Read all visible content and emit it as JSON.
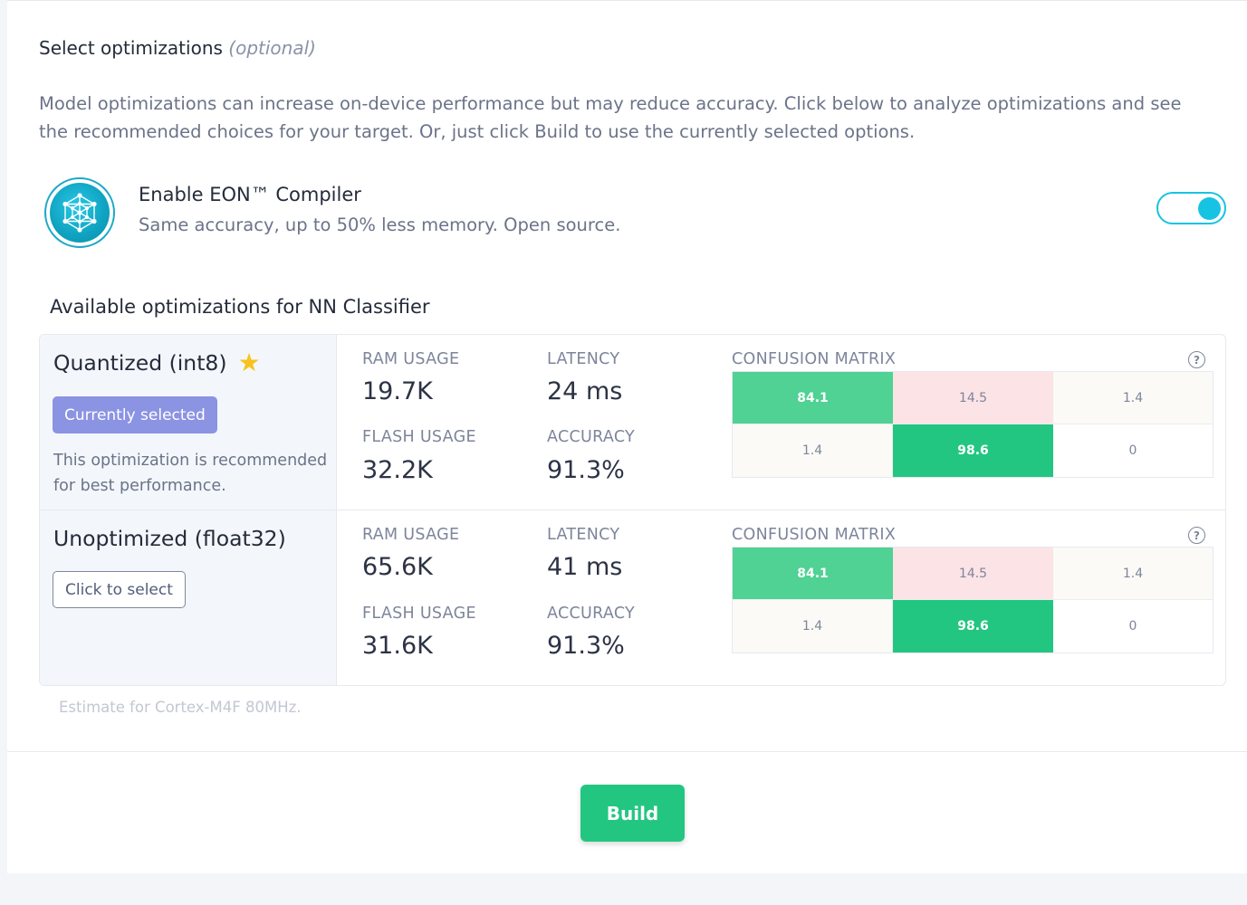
{
  "header": {
    "title": "Select optimizations",
    "title_optional": "(optional)",
    "description": "Model optimizations can increase on-device performance but may reduce accuracy. Click below to analyze optimizations and see the recommended choices for your target. Or, just click Build to use the currently selected options."
  },
  "eon": {
    "icon": "neural-network-icon",
    "title": "Enable EON™ Compiler",
    "subtitle": "Same accuracy, up to 50% less memory. Open source.",
    "enabled": true,
    "accent_color": "#17c3e3"
  },
  "optimizations": {
    "title": "Available optimizations for NN Classifier",
    "labels": {
      "ram": "RAM USAGE",
      "latency": "LATENCY",
      "flash": "FLASH USAGE",
      "accuracy": "ACCURACY",
      "confusion": "CONFUSION MATRIX"
    },
    "rows": [
      {
        "name": "Quantized (int8)",
        "recommended": true,
        "button_label": "Currently selected",
        "note": "This optimization is recommended for best performance.",
        "ram": "19.7K",
        "latency": "24 ms",
        "flash": "32.2K",
        "accuracy": "91.3%",
        "matrix": [
          [
            "84.1",
            "14.5",
            "1.4"
          ],
          [
            "1.4",
            "98.6",
            "0"
          ]
        ]
      },
      {
        "name": "Unoptimized (float32)",
        "recommended": false,
        "button_label": "Click to select",
        "note": "",
        "ram": "65.6K",
        "latency": "41 ms",
        "flash": "31.6K",
        "accuracy": "91.3%",
        "matrix": [
          [
            "84.1",
            "14.5",
            "1.4"
          ],
          [
            "1.4",
            "98.6",
            "0"
          ]
        ]
      }
    ],
    "estimate": "Estimate for Cortex-M4F 80MHz."
  },
  "footer": {
    "build_label": "Build",
    "build_color": "#23c681"
  }
}
